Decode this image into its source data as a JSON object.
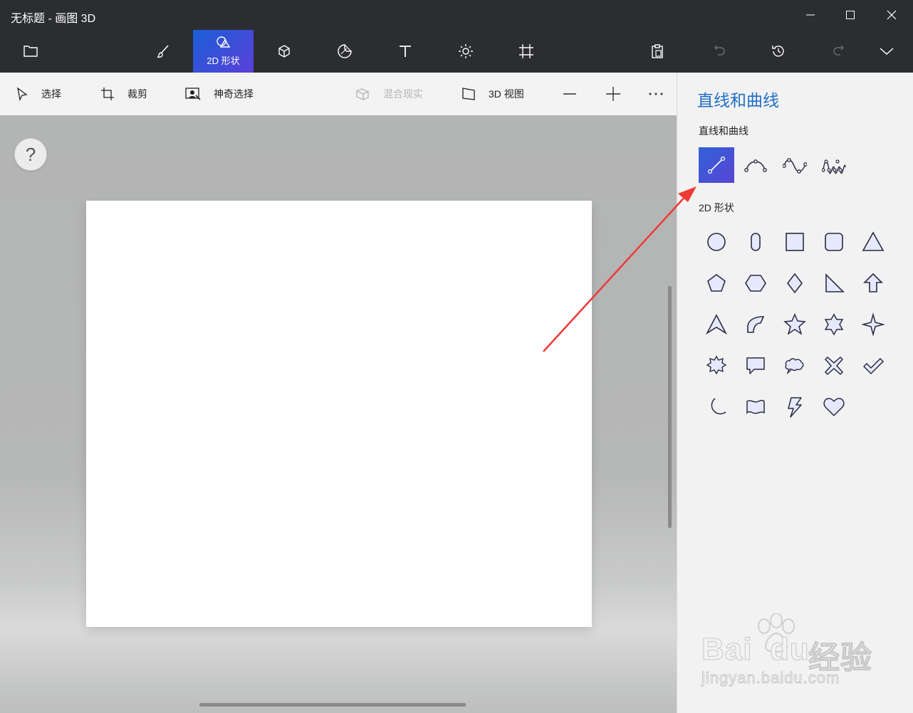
{
  "window": {
    "title": "无标题 - 画图 3D",
    "controls": [
      "minimize-icon",
      "maximize-icon",
      "close-icon"
    ]
  },
  "ribbon": {
    "active_tab": "2D 形状",
    "tabs": [
      {
        "id": "menu",
        "icon": "folder-icon",
        "label": ""
      },
      {
        "id": "brushes",
        "icon": "brush-icon",
        "label": ""
      },
      {
        "id": "2d-shapes",
        "icon": "shapes-2d-icon",
        "label": "2D 形状"
      },
      {
        "id": "3d-shapes",
        "icon": "cube-icon",
        "label": ""
      },
      {
        "id": "stickers",
        "icon": "sticker-icon",
        "label": ""
      },
      {
        "id": "text",
        "icon": "text-icon",
        "label": ""
      },
      {
        "id": "effects",
        "icon": "sun-icon",
        "label": ""
      },
      {
        "id": "canvas",
        "icon": "canvas-icon",
        "label": ""
      }
    ],
    "right_actions": [
      "paste-icon",
      "undo-icon",
      "history-icon",
      "redo-icon",
      "expand-icon"
    ]
  },
  "toolbar": {
    "select": "选择",
    "crop": "裁剪",
    "magic_select": "神奇选择",
    "mixed_reality": "混合现实",
    "view_3d": "3D 视图",
    "zoom_out": "—",
    "zoom_in": "+",
    "more": "···"
  },
  "canvas": {
    "help": "?"
  },
  "panel": {
    "title": "直线和曲线",
    "lines_section": "直线和曲线",
    "shapes_section": "2D 形状",
    "lines": [
      "line-icon",
      "curve-icon",
      "s-curve-icon",
      "multi-curve-icon"
    ],
    "selected_line": "line-icon",
    "shapes": [
      "circle-icon",
      "capsule-icon",
      "square-icon",
      "rounded-square-icon",
      "triangle-icon",
      "pentagon-icon",
      "hexagon-icon",
      "diamond-icon",
      "right-triangle-icon",
      "arrow-up-icon",
      "arrowhead-icon",
      "quarter-circle-icon",
      "star-5-icon",
      "star-6-icon",
      "star-4-icon",
      "burst-icon",
      "speech-bubble-icon",
      "thought-bubble-icon",
      "cross-icon",
      "checkmark-icon",
      "moon-icon",
      "banner-icon",
      "lightning-icon",
      "heart-icon"
    ]
  },
  "watermark": {
    "brand": "Bai",
    "brand2": "du",
    "cn": "经验",
    "url": "jingyan.baidu.com"
  },
  "colors": {
    "accent_blue": "#1f6fc6",
    "active_gradient_start": "#1b5fd6",
    "active_gradient_end": "#5b3fd9",
    "titlebar": "#2b2d31",
    "annotation_arrow": "#ee3a35"
  }
}
